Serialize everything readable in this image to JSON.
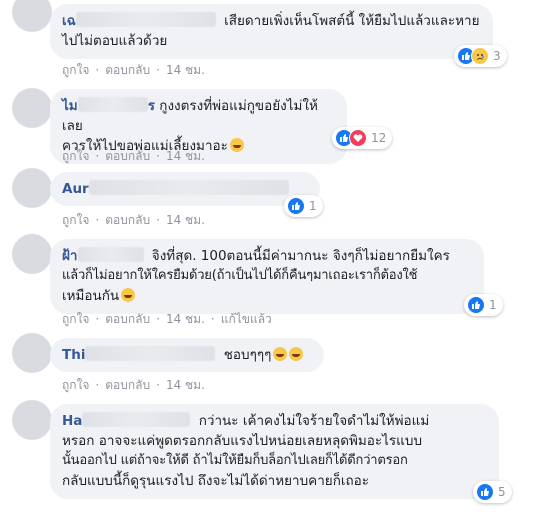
{
  "actions": {
    "like": "ถูกใจ",
    "reply": "ตอบกลับ",
    "sep": "·"
  },
  "comments": [
    {
      "author_visible": "เฉ",
      "text": "เสียดายเพิ่งเห็นโพสต์นี้ ให้ยืมไปแล้วและหายไปไม่ตอบแล้วด้วย",
      "line1": "เสียดายเพิ่งเห็นโพสต์นี้ ให้ยืมไปแล้วและหาย",
      "line2": "ไปไม่ตอบแล้วด้วย",
      "time": "14 ชม.",
      "reaction_count": "3",
      "reaction_icons": [
        "like-icon",
        "sad-icon"
      ]
    },
    {
      "author_visible": "ไม",
      "author_tail": "ร",
      "line1": "กูงงตรงที่พ่อแม่กูขอยังไม่ให้เลย",
      "line2": "ควรให้ไปขอพ่อแม่เลี้ยงมาอะ",
      "time": "14 ชม.",
      "reaction_count": "12",
      "reaction_icons": [
        "like-icon",
        "love-icon"
      ]
    },
    {
      "author_visible": "Aur",
      "time": "14 ชม.",
      "reaction_count": "1",
      "reaction_icons": [
        "like-icon"
      ]
    },
    {
      "author_visible": "ฝ้า",
      "line1": "จิงที่สุด. 100ตอนนี้มีค่ามากนะ จิงๆก็ไม่อยากยืมใคร",
      "line2": "แล้วก็ไม่อยากให้ใครยืมด้วย(ถ้าเป็นไปได้ก็คืนๆมาเถอะเราก็ต้องใช้",
      "line3": "เหมือนกัน",
      "time": "14 ชม.",
      "edited": "แก้ไขแล้ว",
      "reaction_count": "1",
      "reaction_icons": [
        "like-icon"
      ]
    },
    {
      "author_visible": "Thi",
      "line1": "ชอบๆๆๆ",
      "time": "14 ชม.",
      "reaction_icons": []
    },
    {
      "author_visible": "Ha",
      "line1": "กว่านะ เค้าคงไม่ใจร้ายใจดำไม่ให้พ่อแม่",
      "line2": "หรอก อาจจะแค่พูดตรอกกลับแรงไปหน่อยเลยหลุดพิมอะไรแบบ",
      "line3": "นั้นออกไป แต่ถ้าจะให้ดี ถ้าไม่ให้ยืมก็บล็อกไปเลยก็ได้ดีกว่าตรอก",
      "line4": "กลับแบบนี้ก็ดูรุนแรงไป ถึงจะไม่ได้ด่าหยาบคายก็เถอะ",
      "reaction_count": "5",
      "reaction_icons": [
        "like-icon"
      ]
    }
  ],
  "colors": {
    "author": "#365899",
    "bubble": "#f1f2f5",
    "meta": "#90949c",
    "like": "#1877f2"
  }
}
